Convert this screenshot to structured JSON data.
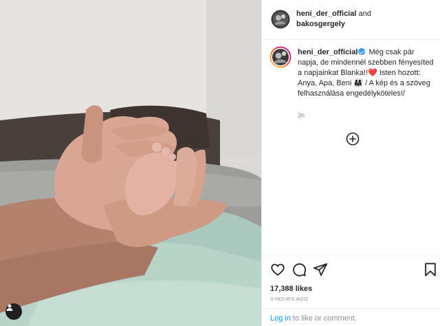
{
  "header": {
    "username_primary": "heni_der_official",
    "connector": " and",
    "username_secondary": "bakosgergely"
  },
  "caption": {
    "username": "heni_der_official",
    "body": "Még csak pár napja, de mindennél szebben fényesíted a napjainkat Blanka!!❤️ Isten hozott: Anya, Apa, Beni 👨‍👩‍👧 / A kép és a szöveg felhasználása engedélyköteles!/",
    "time": "3h"
  },
  "post": {
    "likes": "17,388 likes",
    "timestamp": "3 HOURS AGO"
  },
  "footer": {
    "login_link": "Log in",
    "rest": " to like or comment."
  },
  "icons": {
    "heart": "heart-icon",
    "comment": "comment-icon",
    "share": "share-icon",
    "save": "bookmark-icon",
    "add": "add-circle-icon",
    "tag": "user-tag-icon"
  },
  "colors": {
    "link": "#0095f6",
    "verified": "#3897f0",
    "muted": "#8e8e8e"
  }
}
